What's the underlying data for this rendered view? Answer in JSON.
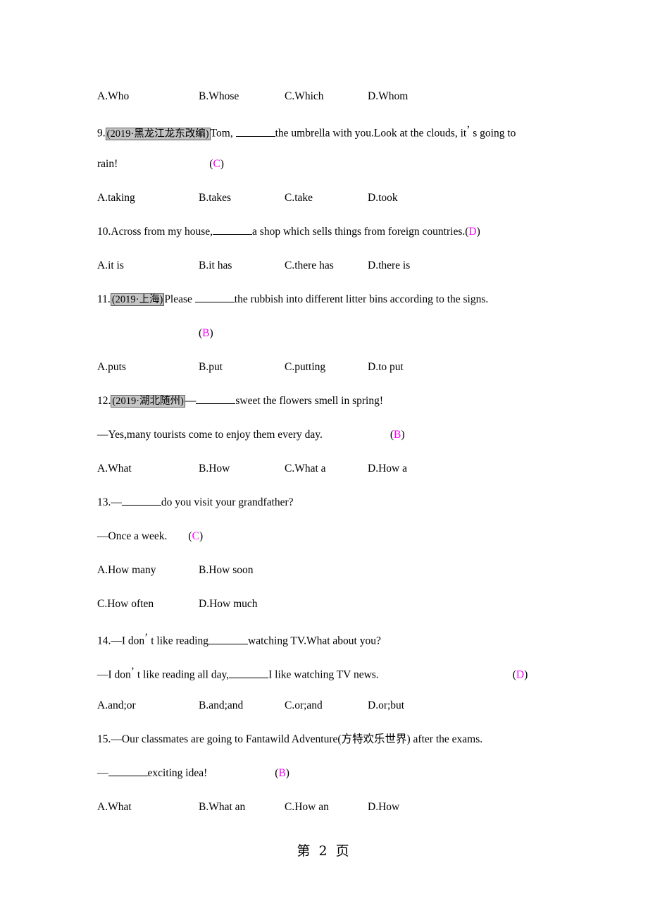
{
  "document": {
    "page_footer": "第 2 页",
    "answer_color": "#ff00ff",
    "tag_background": "#c4c4c4"
  },
  "q8_options": {
    "a": "A.Who",
    "b": "B.Whose",
    "c": "C.Which",
    "d": "D.Whom"
  },
  "q9": {
    "number": "9.",
    "source_tag": "(2019·黑龙江龙东改编)",
    "stem_before": "Tom, ",
    "stem_after": "the umbrella with you.Look at the clouds, it",
    "apostrophe": "’",
    "stem_tail": " s going to",
    "stem_line2": "rain!",
    "answer_open": "(",
    "answer_letter": "C",
    "answer_close": ")",
    "options": {
      "a": "A.taking",
      "b": "B.takes",
      "c": "C.take",
      "d": "D.took"
    }
  },
  "q10": {
    "number": "10.",
    "stem_before": "Across from my house,",
    "stem_after": "a shop which sells things from foreign countries.",
    "answer_open": "(",
    "answer_letter": "D",
    "answer_close": ")",
    "options": {
      "a": "A.it is",
      "b": "B.it has",
      "c": "C.there has",
      "d": "D.there is"
    }
  },
  "q11": {
    "number": "11.",
    "source_tag": "(2019·上海)",
    "stem_before": "Please ",
    "stem_after": "the rubbish into different litter bins according to the signs.",
    "answer_open": "(",
    "answer_letter": "B",
    "answer_close": ")",
    "options": {
      "a": "A.puts",
      "b": "B.put",
      "c": "C.putting",
      "d": "D.to put"
    }
  },
  "q12": {
    "number": "12.",
    "source_tag": "(2019·湖北随州)",
    "stem_dash": "—",
    "stem_after": "sweet the flowers smell in spring!",
    "reply": "—Yes,many tourists come to enjoy them every day.",
    "answer_open": "(",
    "answer_letter": "B",
    "answer_close": ")",
    "options": {
      "a": "A.What",
      "b": "B.How",
      "c": "C.What a",
      "d": "D.How a"
    }
  },
  "q13": {
    "number": "13.",
    "stem_dash": "—",
    "stem_after": "do you visit your grandfather?",
    "reply": "—Once a week.",
    "answer_open": "(",
    "answer_letter": "C",
    "answer_close": ")",
    "options": {
      "a": "A.How many",
      "b": "B.How soon",
      "c": "C.How often",
      "d": "D.How much"
    }
  },
  "q14": {
    "number": "14.",
    "stem_dash": "—",
    "stem_before": "I don",
    "apostrophe": "’",
    "stem_mid": " t like reading",
    "stem_after": "watching TV.What about you?",
    "reply_dash": "—",
    "reply_before": "I don",
    "reply_apostrophe": "’",
    "reply_mid": " t like reading all day,",
    "reply_after": "I like watching TV news.",
    "answer_open": "(",
    "answer_letter": "D",
    "answer_close": ")",
    "options": {
      "a": "A.and;or",
      "b": "B.and;and",
      "c": "C.or;and",
      "d": "D.or;but"
    }
  },
  "q15": {
    "number": "15.",
    "stem_dash": "—",
    "stem_text": "Our classmates are going to Fantawild Adventure(方特欢乐世界) after the exams.",
    "reply_dash": "—",
    "reply_after": "exciting idea!",
    "answer_open": "(",
    "answer_letter": "B",
    "answer_close": ")",
    "options": {
      "a": "A.What",
      "b": "B.What an",
      "c": "C.How an",
      "d": "D.How"
    }
  }
}
